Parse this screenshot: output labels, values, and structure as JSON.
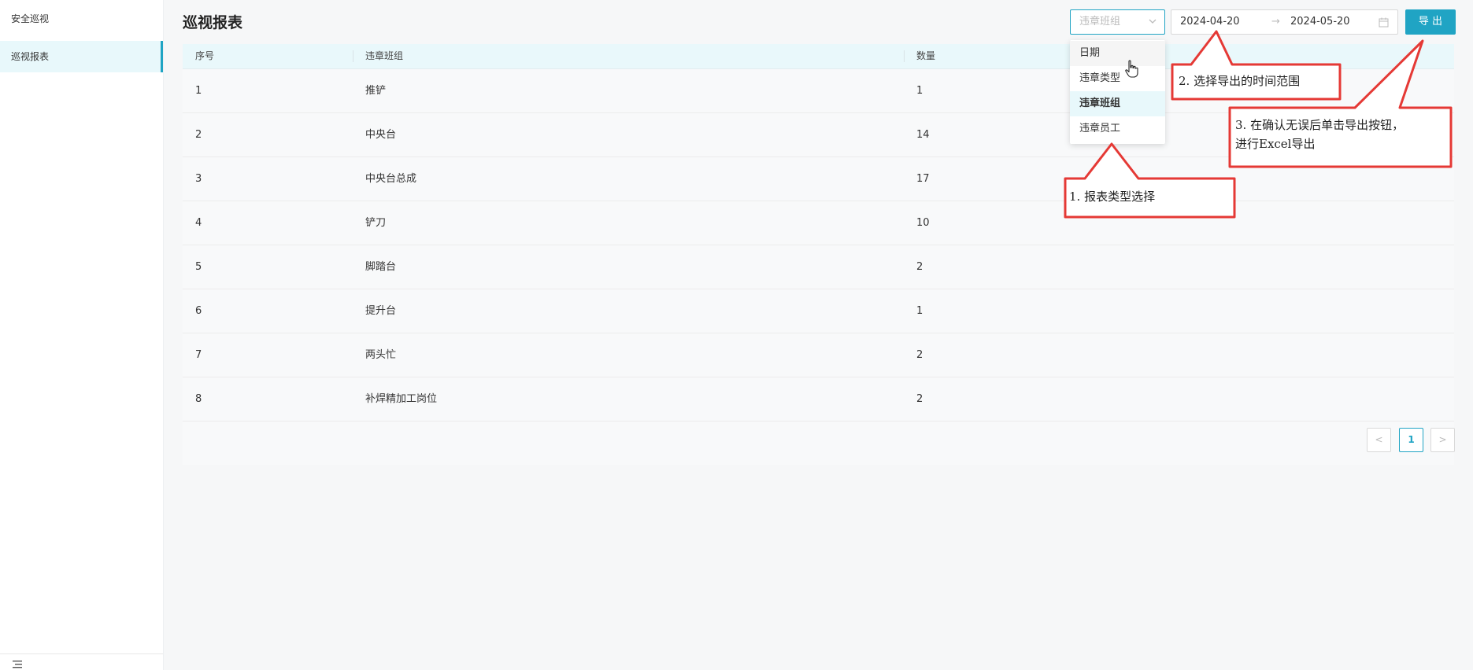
{
  "sidebar": {
    "items": [
      {
        "label": "安全巡视"
      },
      {
        "label": "巡视报表"
      }
    ]
  },
  "header": {
    "title": "巡视报表"
  },
  "controls": {
    "select_placeholder": "违章班组",
    "date_start": "2024-04-20",
    "date_separator": "→",
    "date_end": "2024-05-20",
    "export_label": "导 出"
  },
  "dropdown": {
    "options": [
      "日期",
      "违章类型",
      "违章班组",
      "违章员工"
    ],
    "selected": "违章班组"
  },
  "table": {
    "columns": [
      "序号",
      "违章班组",
      "数量"
    ],
    "rows": [
      [
        "1",
        "推铲",
        "1"
      ],
      [
        "2",
        "中央台",
        "14"
      ],
      [
        "3",
        "中央台总成",
        "17"
      ],
      [
        "4",
        "铲刀",
        "10"
      ],
      [
        "5",
        "脚踏台",
        "2"
      ],
      [
        "6",
        "提升台",
        "1"
      ],
      [
        "7",
        "两头忙",
        "2"
      ],
      [
        "8",
        "补焊精加工岗位",
        "2"
      ]
    ]
  },
  "pagination": {
    "prev": "<",
    "current": "1",
    "next": ">"
  },
  "annotations": {
    "callout1": "1. 报表类型选择",
    "callout2": "2. 选择导出的时间范围",
    "callout3_line1": "3. 在确认无误后单击导出按钮，",
    "callout3_line2": "进行Excel导出"
  },
  "colors": {
    "accent": "#20a4c4",
    "callout_border": "#e53935",
    "header_bg": "#e9f8fb"
  }
}
